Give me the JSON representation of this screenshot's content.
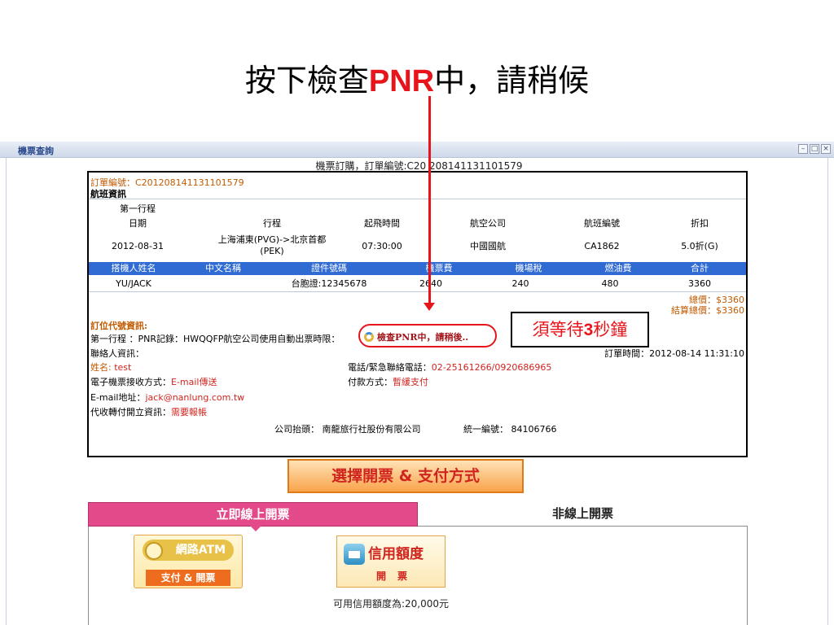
{
  "slide": {
    "title_prefix": "按下檢查",
    "title_pnr": "PNR",
    "title_suffix": "中，請稍候"
  },
  "window": {
    "title": "機票查詢",
    "buttons": [
      "–",
      "□",
      "×"
    ]
  },
  "panel": {
    "title": "機票訂購，訂單編號:C20 208141131101579",
    "order_label": "訂單編號：",
    "order_no": "C201208141131101579",
    "flight_section": "航班資訊",
    "trip": "第一行程",
    "flight_headers": [
      "日期",
      "行程",
      "起飛時間",
      "航空公司",
      "航班編號",
      "折扣"
    ],
    "flight_row": {
      "date": "2012-08-31",
      "route_1": "上海浦東(PVG)->北京首都",
      "route_2": "(PEK)",
      "time": "07:30:00",
      "airline": "中國國航",
      "flight_no": "CA1862",
      "discount": "5.0折(G)"
    },
    "pax_headers": [
      "搭機人姓名",
      "中文名稱",
      "證件號碼",
      "機票費",
      "機場稅",
      "燃油費",
      "合計"
    ],
    "pax_row": {
      "name": "YU/JACK",
      "cname": "",
      "doc": "台胞證:12345678",
      "fare": "2640",
      "tax": "240",
      "fuel": "480",
      "total": "3360"
    },
    "total_price": "總價：$3360",
    "settle_price": "結算總價：$3360",
    "pnr_section": "訂位代號資訊:",
    "pnr_line": "第一行程 ：PNR記錄：HWQQFP航空公司使用自動出票時限：",
    "checking": "檢查PNR中，請稍後..",
    "contact_section": "聯絡人資訊：",
    "order_time": "訂單時間：2012-08-14 11:31:10",
    "name_label": "姓名:",
    "name_value": "test",
    "phone_label": "電話/緊急聯絡電話：",
    "phone_value": "02-25161266/0920686965",
    "eticket_label": "電子機票接收方式：",
    "eticket_value": "E-mail傳送",
    "pay_label": "付款方式：",
    "pay_value": "暫緩支付",
    "email_label": "E-mail地址：",
    "email_value": "jack@nanlung.com.tw",
    "receipt_label": "代收轉付開立資訊：",
    "receipt_value": "需要報帳",
    "company": "公司抬頭： 南龍旅行社股份有限公司",
    "tax_id": "統一編號： 84106766"
  },
  "wait_note": {
    "prefix": "須等待",
    "num": "3",
    "suffix": "秒鐘"
  },
  "choose_button": "選擇開票 & 支付方式",
  "tabs": {
    "online": "立即線上開票",
    "offline": "非線上開票"
  },
  "atm_button": {
    "top": "網路ATM",
    "bottom": "支付 & 開票"
  },
  "credit_button": {
    "label": "信用額度",
    "sub": "開票"
  },
  "credit_note": "可用信用額度為:20,000元"
}
